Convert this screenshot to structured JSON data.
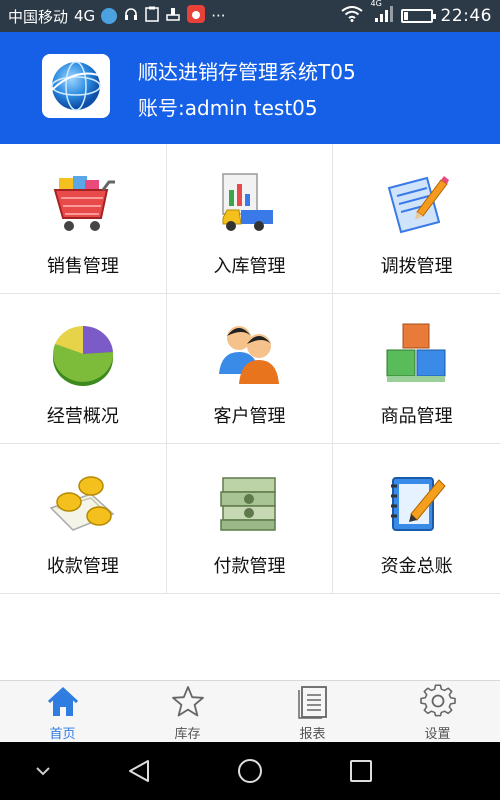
{
  "status_bar": {
    "carrier": "中国移动",
    "network": "4G",
    "signal_network": "4G",
    "time": "22:46",
    "more": "···"
  },
  "header": {
    "title": "顺达进销存管理系统T05",
    "account": "账号:admin test05"
  },
  "modules": [
    {
      "label": "销售管理",
      "icon": "shopping-cart-icon"
    },
    {
      "label": "入库管理",
      "icon": "delivery-truck-icon"
    },
    {
      "label": "调拨管理",
      "icon": "notepad-pencil-icon"
    },
    {
      "label": "经营概况",
      "icon": "pie-chart-icon"
    },
    {
      "label": "客户管理",
      "icon": "users-icon"
    },
    {
      "label": "商品管理",
      "icon": "product-boxes-icon"
    },
    {
      "label": "收款管理",
      "icon": "coins-icon"
    },
    {
      "label": "付款管理",
      "icon": "money-stack-icon"
    },
    {
      "label": "资金总账",
      "icon": "ledger-book-icon"
    }
  ],
  "tabs": [
    {
      "label": "首页",
      "icon": "home-icon",
      "active": true
    },
    {
      "label": "库存",
      "icon": "star-icon",
      "active": false
    },
    {
      "label": "报表",
      "icon": "report-icon",
      "active": false
    },
    {
      "label": "设置",
      "icon": "gear-icon",
      "active": false
    }
  ],
  "colors": {
    "header_bg": "#1660e8",
    "status_bar_bg": "#2c3a48",
    "tab_active": "#2f7de1",
    "tab_inactive": "#555555"
  }
}
